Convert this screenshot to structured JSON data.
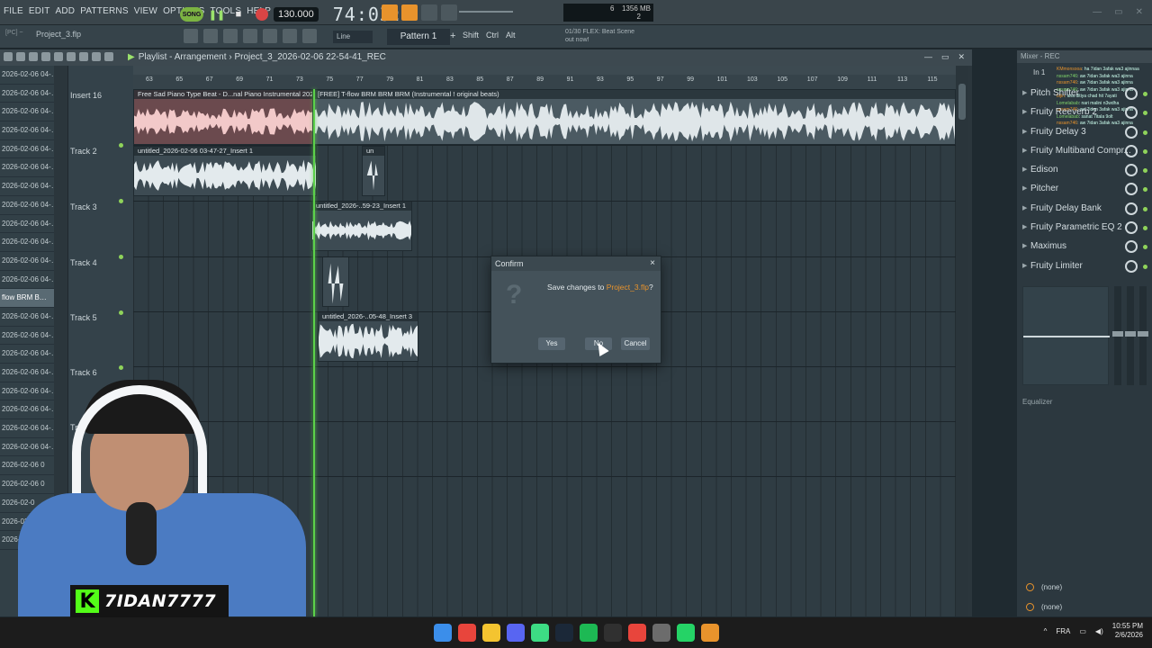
{
  "menubar": {
    "items": [
      "FILE",
      "EDIT",
      "ADD",
      "PATTERNS",
      "VIEW",
      "OPTIONS",
      "TOOLS",
      "HELP"
    ],
    "song_label": "SONG",
    "tempo": "130.000",
    "time": "74:03",
    "time_small": "21",
    "cpu": "6",
    "memory": "1356 MB",
    "polyphony": "2"
  },
  "toolbar2": {
    "pc_tag": "[PC] ~",
    "project_name": "Project_3.flp",
    "snap": "Line",
    "pattern": "Pattern 1",
    "pattern_add": "+",
    "mods": [
      "Shift",
      "Ctrl",
      "Alt"
    ],
    "hint_line1": "01/30  FLEX: Beat Scene",
    "hint_line2": "out now!"
  },
  "playlist": {
    "title_prefix": "Playlist - Arrangement",
    "title_sep": "›",
    "title_project": "Project_3_2026-02-06 22-54-41_REC",
    "ruler": [
      "63",
      "65",
      "67",
      "69",
      "71",
      "73",
      "75",
      "77",
      "79",
      "81",
      "83",
      "85",
      "87",
      "89",
      "91",
      "93",
      "95",
      "97",
      "99",
      "101",
      "103",
      "105",
      "107",
      "109",
      "111",
      "113",
      "115"
    ],
    "tracks": [
      "Insert 16",
      "Track 2",
      "Track 3",
      "Track 4",
      "Track 5",
      "Track 6",
      "Track 7"
    ],
    "left_items": [
      "2026-02-06 04-…",
      "2026-02-06 04-…",
      "2026-02-06 04-…",
      "2026-02-06 04-…",
      "2026-02-06 04-…",
      "2026-02-06 04-…",
      "2026-02-06 04-…",
      "2026-02-06 04-…",
      "2026-02-06 04-…",
      "2026-02-06 04-…",
      "2026-02-06 04-…",
      "2026-02-06 04-…",
      "flow BRM B…",
      "2026-02-06 04-…",
      "2026-02-06 04-…",
      "2026-02-06 04-…",
      "2026-02-06 04-…",
      "2026-02-06 04-…",
      "2026-02-06 04-…",
      "2026-02-06 04-…",
      "2026-02-06 04-…",
      "2026-02-06 0",
      "2026-02-06 0",
      "2026-02-0",
      "2026-02",
      "2026-02"
    ],
    "clips": [
      "Free Sad Piano Type Beat - D...nal Piano Instrumental 2022",
      "[FREE] T-flow BRM BRM BRM (Instrumental ! original beats)",
      "untitled_2026-02-06 03-47-27_Insert 1",
      "un",
      "untitled_2026-..59-23_Insert 1",
      "untitled_2026-..05-48_Insert 3"
    ]
  },
  "dialog": {
    "title": "Confirm",
    "close": "×",
    "icon": "?",
    "message_prefix": "Save changes to ",
    "message_file": "Project_3.flp",
    "message_suffix": "?",
    "yes": "Yes",
    "no": "No",
    "cancel": "Cancel"
  },
  "mixer": {
    "header": "Mixer - REC",
    "insert": "In 1",
    "fx": [
      "Pitch Shifter",
      "Fruity Reeverb 2",
      "Fruity Delay 3",
      "Fruity Multiband Compr...",
      "Edison",
      "Pitcher",
      "Fruity Delay Bank",
      "Fruity Parametric EQ 2",
      "Maximus",
      "Fruity Limiter"
    ],
    "eq_label": "Equalizer",
    "none1": "(none)",
    "none2": "(none)",
    "chat": [
      {
        "user": "KMmonsooa",
        "msg": "ha 7idan 3afak wa3 ajinnaa"
      },
      {
        "user": "nssam746",
        "msg": "aw 7idan 3afak wa3 ajinna"
      },
      {
        "user": "nssam746",
        "msg": "aw 7idan 3afak wa3 ajinna"
      },
      {
        "user": "nssam746",
        "msg": "aw 7idan 3afak wa3 ajinna"
      },
      {
        "user": "bijin",
        "msg": "ana dltiya chad hit 7ayati"
      },
      {
        "user": "Lomelabab",
        "msg": "nari malini n3wdha"
      },
      {
        "user": "nssam746",
        "msg": "aw 7idan 3afak wa3 ajinna"
      },
      {
        "user": "Lomelabab",
        "msg": "sanat 7itala 9olt"
      },
      {
        "user": "nssam746",
        "msg": "aw 7idan 3afak wa3 ajinna"
      }
    ]
  },
  "streamer": {
    "name": "7IDAN7777",
    "logo_letter": "K"
  },
  "taskbar": {
    "lang": "FRA",
    "time": "10:55 PM",
    "date": "2/6/2026",
    "icons": [
      "windows-start-icon",
      "chrome-icon",
      "file-explorer-icon",
      "discord-icon",
      "apps-icon",
      "steam-icon",
      "spotify-icon",
      "obs-icon",
      "chrome-alt-icon",
      "settings-icon",
      "whatsapp-icon",
      "fl-studio-icon"
    ]
  },
  "colors": {
    "accent_orange": "#e8932c",
    "playhead_green": "#5cd14a",
    "kick_green": "#53fc18"
  }
}
